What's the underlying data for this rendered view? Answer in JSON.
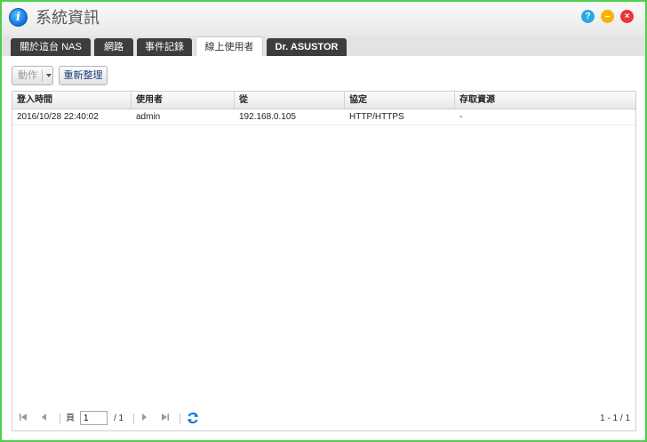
{
  "window": {
    "title": "系統資訊",
    "app_icon_glyph": "i"
  },
  "titlebar_buttons": {
    "help": "?",
    "minimize": "–",
    "close": "×"
  },
  "tabs": [
    {
      "label": "關於這台 NAS",
      "active": false
    },
    {
      "label": "網路",
      "active": false
    },
    {
      "label": "事件記錄",
      "active": false
    },
    {
      "label": "線上使用者",
      "active": true
    },
    {
      "label": "Dr. ASUSTOR",
      "active": false
    }
  ],
  "toolbar": {
    "action_label": "動作",
    "refresh_label": "重新整理"
  },
  "table": {
    "columns": [
      "登入時間",
      "使用者",
      "從",
      "協定",
      "存取資源"
    ],
    "rows": [
      [
        "2016/10/28 22:40:02",
        "admin",
        "192.168.0.105",
        "HTTP/HTTPS",
        "-"
      ]
    ]
  },
  "pager": {
    "page_label": "頁",
    "page_value": "1",
    "page_total": "/ 1",
    "range": "1 - 1 / 1"
  },
  "colors": {
    "window_border": "#4cd04c",
    "tab_dark": "#3d3d3d",
    "help": "#29a9e0",
    "minimize": "#f6b400",
    "close": "#e8353c",
    "refresh_icon": "#1a7bd6"
  }
}
